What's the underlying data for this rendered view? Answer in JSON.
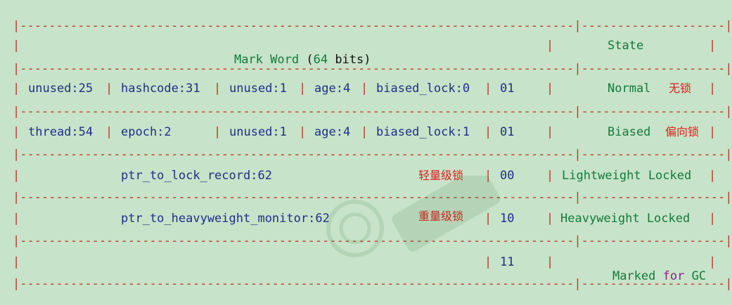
{
  "table": {
    "divider": "|-----------------------------------------------------------------------------|--------------------|",
    "row_bar": "|",
    "header": {
      "mark_word_label": "Mark Word",
      "mark_word_paren_open": "(",
      "mark_word_bits": "64",
      "mark_word_bits_unit": "bits)",
      "state_label": "State"
    },
    "normal": {
      "unused": "unused:25",
      "hashcode": "hashcode:31",
      "unused2": "unused:1",
      "age": "age:4",
      "biased_lock": "biased_lock:0",
      "lock_bits": "01",
      "state": "Normal",
      "state_cn": "无锁"
    },
    "biased": {
      "thread": "thread:54",
      "epoch": "epoch:2",
      "unused": "unused:1",
      "age": "age:4",
      "biased_lock": "biased_lock:1",
      "lock_bits": "01",
      "state": "Biased",
      "state_cn": "偏向锁"
    },
    "lightweight": {
      "ptr": "ptr_to_lock_record:62",
      "note_cn": "轻量级锁",
      "lock_bits": "00",
      "state": "Lightweight Locked"
    },
    "heavyweight": {
      "ptr": "ptr_to_heavyweight_monitor:62",
      "note_cn": "重量级锁",
      "lock_bits": "10",
      "state": "Heavyweight Locked"
    },
    "gc": {
      "lock_bits": "11",
      "state_word1": "Marked",
      "state_word2": "for",
      "state_word3": "GC"
    }
  },
  "colors": {
    "background": "#c7e3c9",
    "dash": "#c0392b",
    "field_text": "#1f2f86",
    "number_text": "#137a3a",
    "chinese_note": "#e21f1f"
  }
}
